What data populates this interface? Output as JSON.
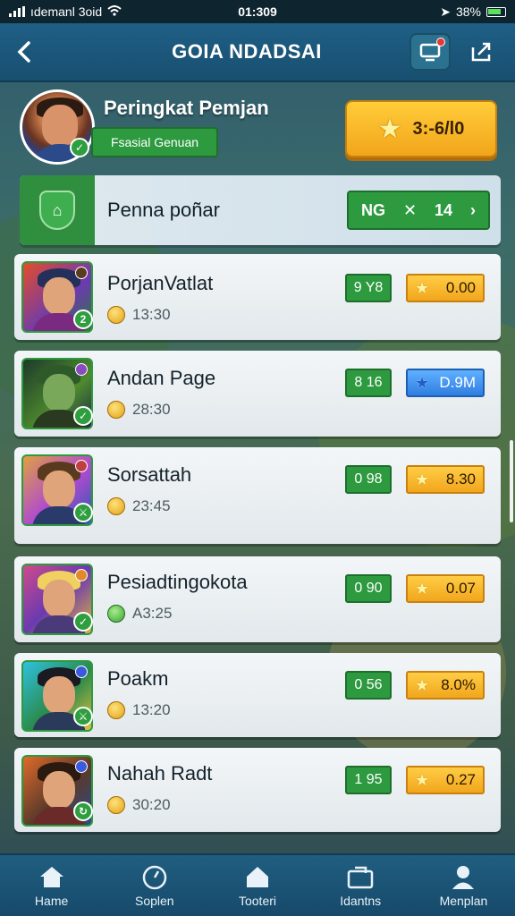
{
  "status_bar": {
    "carrier": "ıdemanl 3oid",
    "time": "01:309",
    "battery": "38%"
  },
  "header": {
    "title": "GOIA NDADSAI",
    "back_label": "<"
  },
  "profile": {
    "title": "Peringkat Pemjan",
    "status": "Fsasial Genuan",
    "score": "3:-6/l0"
  },
  "banner": {
    "title": "Penna poñar",
    "button_prefix": "NG",
    "button_value": "14"
  },
  "players": [
    {
      "name": "PorjanVatlat",
      "time": "13:30",
      "rank": "9 Y8",
      "score": "0.00",
      "score_style": "gold",
      "coin": "gold"
    },
    {
      "name": "Andan Page",
      "time": "28:30",
      "rank": "8 16",
      "score": "D.9M",
      "score_style": "blue",
      "coin": "gold"
    },
    {
      "name": "Sorsattah",
      "time": "23:45",
      "rank": "0 98",
      "score": "8.30",
      "score_style": "gold",
      "coin": "gold"
    },
    {
      "name": "Pesiadtingokota",
      "time": "A3:25",
      "rank": "0 90",
      "score": "0.07",
      "score_style": "gold",
      "coin": "green"
    },
    {
      "name": "Poakm",
      "time": "13:20",
      "rank": "0 56",
      "score": "8.0%",
      "score_style": "gold",
      "coin": "gold"
    },
    {
      "name": "Nahah Radt",
      "time": "30:20",
      "rank": "1 95",
      "score": "0.27",
      "score_style": "gold",
      "coin": "gold"
    }
  ],
  "bottom_nav": [
    {
      "label": "Hame",
      "icon": "home-icon"
    },
    {
      "label": "Soplen",
      "icon": "timer-icon"
    },
    {
      "label": "Tooteri",
      "icon": "house-icon"
    },
    {
      "label": "Idantns",
      "icon": "inbox-icon"
    },
    {
      "label": "Menplan",
      "icon": "profile-icon"
    }
  ],
  "colors": {
    "accent_green": "#2e9a40",
    "accent_gold": "#f2a51a",
    "header_blue": "#1f5f86"
  }
}
